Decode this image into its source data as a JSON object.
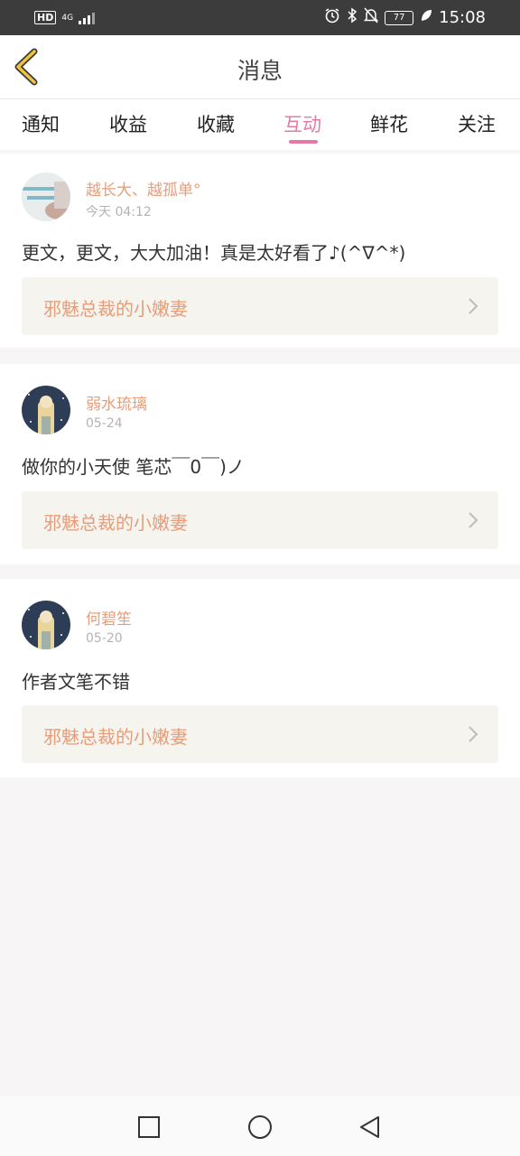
{
  "status_bar": {
    "hd": "HD",
    "network": "4G",
    "battery": "77",
    "time": "15:08"
  },
  "header": {
    "title": "消息"
  },
  "tabs": [
    {
      "label": "通知",
      "active": false
    },
    {
      "label": "收益",
      "active": false
    },
    {
      "label": "收藏",
      "active": false
    },
    {
      "label": "互动",
      "active": true
    },
    {
      "label": "鲜花",
      "active": false
    },
    {
      "label": "关注",
      "active": false
    }
  ],
  "messages": [
    {
      "username": "越长大、越孤单°",
      "time": "今天 04:12",
      "text": "更文，更文，大大加油！真是太好看了♪(^∇^*)",
      "book": "邪魅总裁的小嫩妻"
    },
    {
      "username": "弱水琉璃",
      "time": "05-24",
      "text": "做你的小天使 笔芯￣0￣)ノ",
      "book": "邪魅总裁的小嫩妻"
    },
    {
      "username": "何碧笙",
      "time": "05-20",
      "text": "作者文笔不错",
      "book": "邪魅总裁的小嫩妻"
    }
  ],
  "colors": {
    "accent": "#e67aa6",
    "username": "#e89d79",
    "back_icon": "#f0c33c"
  },
  "icons": [
    "back-icon",
    "chevron-right-icon",
    "alarm-icon",
    "bluetooth-icon",
    "bell-off-icon",
    "leaf-icon"
  ]
}
